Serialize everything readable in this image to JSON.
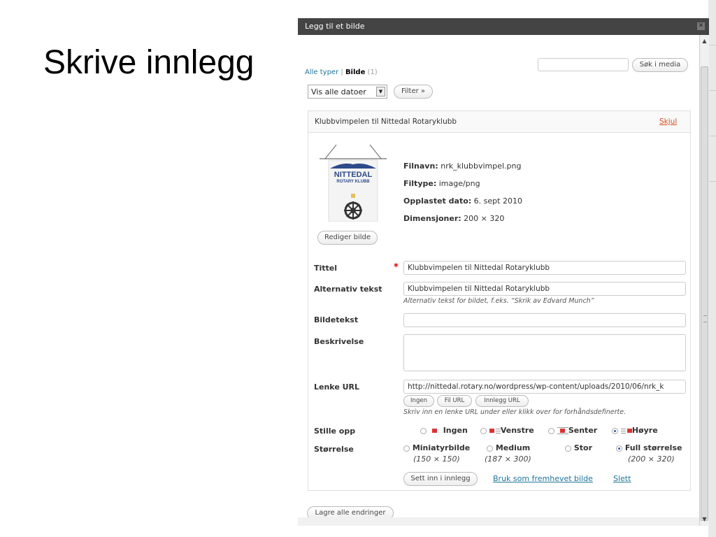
{
  "slide": {
    "title": "Skrive innlegg"
  },
  "dialog": {
    "title": "Legg til et bilde",
    "filter": {
      "all_types": "Alle typer",
      "separator": "|",
      "images": "Bilde",
      "images_count": "(1)",
      "search_value": "",
      "search_button": "Søk i media",
      "date_select": "Vis alle datoer",
      "filter_button": "Filter »"
    },
    "item": {
      "header_title": "Klubbvimpelen til Nittedal Rotaryklubb",
      "hide_link": "Skjul",
      "thumbnail": {
        "brand": "NITTEDAL",
        "brand_sub": "ROTARY KLUBB"
      },
      "meta": {
        "filename_label": "Filnavn:",
        "filename": "nrk_klubbvimpel.png",
        "filetype_label": "Filtype:",
        "filetype": "image/png",
        "uploaded_label": "Opplastet dato:",
        "uploaded": "6. sept 2010",
        "dimensions_label": "Dimensjoner:",
        "dimensions": "200 × 320"
      },
      "edit_image_button": "Rediger bilde",
      "fields": {
        "title_label": "Tittel",
        "required_mark": "*",
        "title_value": "Klubbvimpelen til Nittedal Rotaryklubb",
        "alt_label": "Alternativ tekst",
        "alt_value": "Klubbvimpelen til Nittedal Rotaryklubb",
        "alt_help": "Alternativ tekst for bildet, f.eks. “Skrik av Edvard Munch”",
        "caption_label": "Bildetekst",
        "caption_value": "",
        "description_label": "Beskrivelse",
        "description_value": "",
        "link_label": "Lenke URL",
        "link_value": "http://nittedal.rotary.no/wordpress/wp-content/uploads/2010/06/nrk_k",
        "link_none": "Ingen",
        "link_file": "Fil URL",
        "link_post": "Innlegg URL",
        "link_help": "Skriv inn en lenke URL under eller klikk over for forhåndsdefinerte."
      },
      "alignment": {
        "label": "Stille opp",
        "options": [
          "Ingen",
          "Venstre",
          "Senter",
          "Høyre"
        ],
        "selected": "Høyre"
      },
      "size": {
        "label": "Størrelse",
        "options": [
          {
            "name": "Miniatyrbilde",
            "dims": "(150 × 150)"
          },
          {
            "name": "Medium",
            "dims": "(187 × 300)"
          },
          {
            "name": "Stor",
            "dims": ""
          },
          {
            "name": "Full størrelse",
            "dims": "(200 × 320)"
          }
        ],
        "selected": "Full størrelse"
      },
      "actions": {
        "insert": "Sett inn i innlegg",
        "featured": "Bruk som fremhevet bilde",
        "delete": "Slett"
      }
    },
    "save_all_button": "Lagre alle endringer",
    "close_icon": "close-icon"
  },
  "colors": {
    "link": "#21759b",
    "delete_link": "#d54e21",
    "required": "#d00",
    "titlebar": "#444444"
  }
}
